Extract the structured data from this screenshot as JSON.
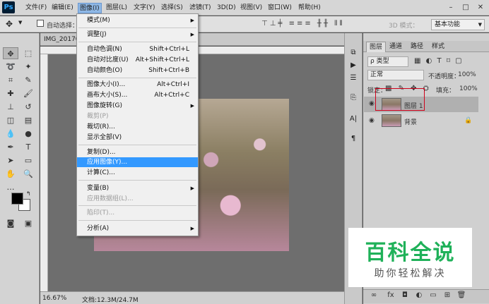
{
  "menubar": {
    "logo": "Ps",
    "items": [
      "文件(F)",
      "编辑(E)",
      "图像(I)",
      "图层(L)",
      "文字(Y)",
      "选择(S)",
      "滤镜(T)",
      "3D(D)",
      "视图(V)",
      "窗口(W)",
      "帮助(H)"
    ],
    "active_index": 2,
    "window_controls": [
      "–",
      "□",
      "✕"
    ]
  },
  "options_bar": {
    "auto_select_label": "自动选择：",
    "mode_label": "3D 模式：",
    "workspace": "基本功能"
  },
  "document": {
    "tab_title": "IMG_20170",
    "zoom": "16.67%",
    "doc_size": "文档:12.3M/24.7M"
  },
  "image_menu": {
    "items": [
      {
        "label": "模式(M)",
        "shortcut": "",
        "submenu": true,
        "disabled": false
      },
      {
        "label": "调整(J)",
        "shortcut": "",
        "submenu": true,
        "disabled": false
      },
      {
        "label": "自动色调(N)",
        "shortcut": "Shift+Ctrl+L",
        "submenu": false,
        "disabled": false
      },
      {
        "label": "自动对比度(U)",
        "shortcut": "Alt+Shift+Ctrl+L",
        "submenu": false,
        "disabled": false
      },
      {
        "label": "自动颜色(O)",
        "shortcut": "Shift+Ctrl+B",
        "submenu": false,
        "disabled": false
      },
      {
        "label": "图像大小(I)...",
        "shortcut": "Alt+Ctrl+I",
        "submenu": false,
        "disabled": false
      },
      {
        "label": "画布大小(S)...",
        "shortcut": "Alt+Ctrl+C",
        "submenu": false,
        "disabled": false
      },
      {
        "label": "图像旋转(G)",
        "shortcut": "",
        "submenu": true,
        "disabled": false
      },
      {
        "label": "裁剪(P)",
        "shortcut": "",
        "submenu": false,
        "disabled": true
      },
      {
        "label": "裁切(R)...",
        "shortcut": "",
        "submenu": false,
        "disabled": false
      },
      {
        "label": "显示全部(V)",
        "shortcut": "",
        "submenu": false,
        "disabled": false
      },
      {
        "label": "复制(D)...",
        "shortcut": "",
        "submenu": false,
        "disabled": false
      },
      {
        "label": "应用图像(Y)...",
        "shortcut": "",
        "submenu": false,
        "disabled": false,
        "highlighted": true
      },
      {
        "label": "计算(C)...",
        "shortcut": "",
        "submenu": false,
        "disabled": false
      },
      {
        "label": "变量(B)",
        "shortcut": "",
        "submenu": true,
        "disabled": false
      },
      {
        "label": "应用数据组(L)...",
        "shortcut": "",
        "submenu": false,
        "disabled": true
      },
      {
        "label": "陷印(T)...",
        "shortcut": "",
        "submenu": false,
        "disabled": true
      },
      {
        "label": "分析(A)",
        "shortcut": "",
        "submenu": true,
        "disabled": false
      }
    ]
  },
  "layers_panel": {
    "tabs": [
      "图层",
      "通道",
      "路径",
      "样式"
    ],
    "filter_kind": "ρ 类型",
    "blend_mode": "正常",
    "opacity_label": "不透明度：",
    "opacity_value": "100%",
    "lock_label": "锁定：",
    "fill_label": "填充：",
    "fill_value": "100%",
    "layers": [
      {
        "name": "图层 1",
        "selected": true
      },
      {
        "name": "背景",
        "selected": false
      }
    ],
    "lock_icon": "🔒"
  },
  "watermark": {
    "main": "百科全说",
    "sub": "助你轻松解决"
  }
}
